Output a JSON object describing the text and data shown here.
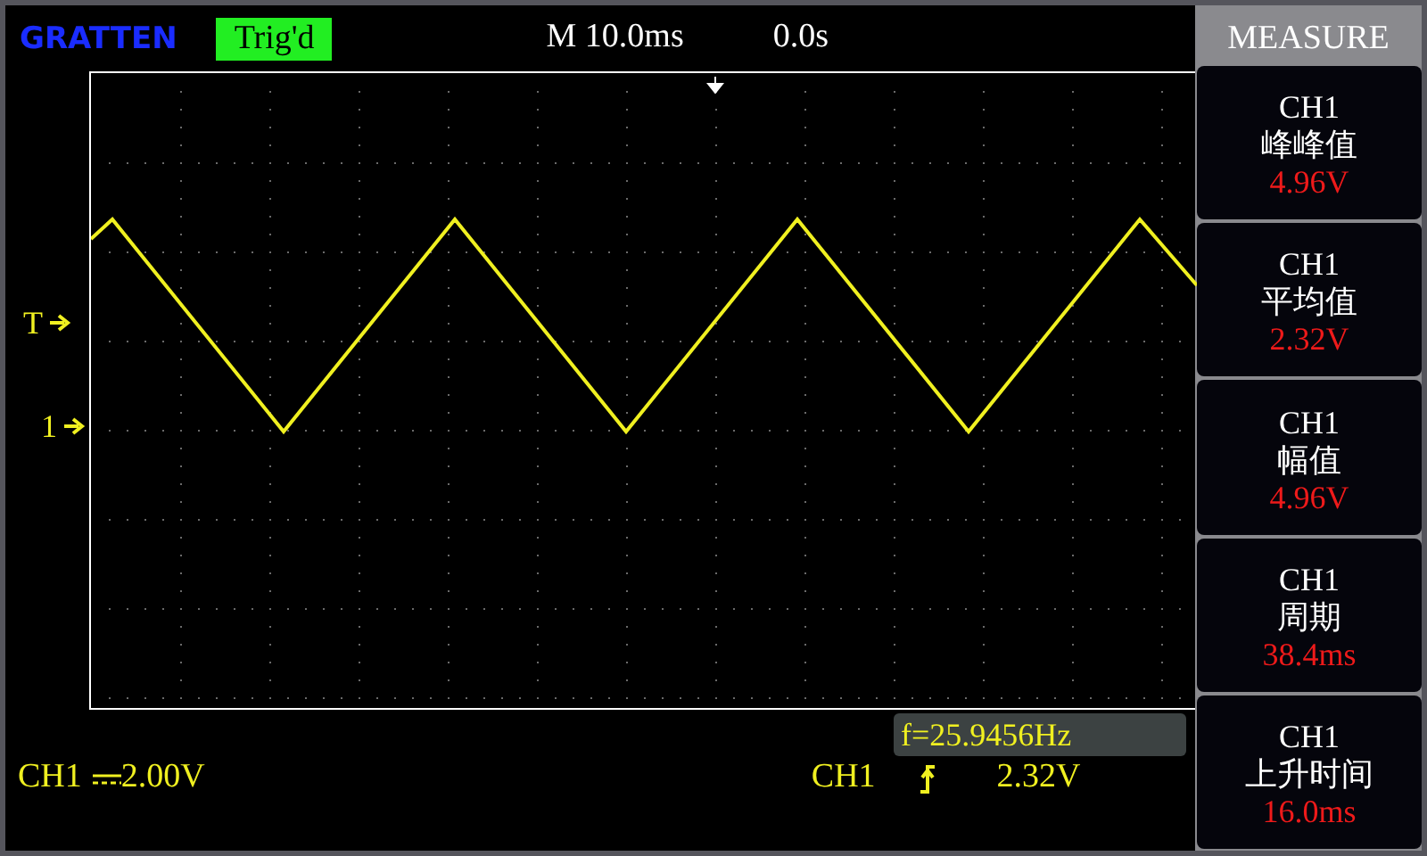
{
  "logo": "GRATTEN",
  "trigger_status": "Trig'd",
  "timebase": "M 10.0ms",
  "trigger_position": "0.0s",
  "markers": [
    {
      "label": "T",
      "kind": "trigger"
    },
    {
      "label": "1",
      "kind": "channel"
    }
  ],
  "frequency": "f=25.9456Hz",
  "channel": {
    "name": "CH1",
    "scale": "2.00V"
  },
  "trigger": {
    "source": "CH1",
    "rising_edge": true,
    "level": "2.32V"
  },
  "measure": {
    "title": "MEASURE",
    "items": [
      {
        "channel": "CH1",
        "name": "峰峰值",
        "value": "4.96V"
      },
      {
        "channel": "CH1",
        "name": "平均值",
        "value": "2.32V"
      },
      {
        "channel": "CH1",
        "name": "幅值",
        "value": "4.96V"
      },
      {
        "channel": "CH1",
        "name": "周期",
        "value": "38.4ms"
      },
      {
        "channel": "CH1",
        "name": "上升时间",
        "value": "16.0ms"
      }
    ]
  }
}
